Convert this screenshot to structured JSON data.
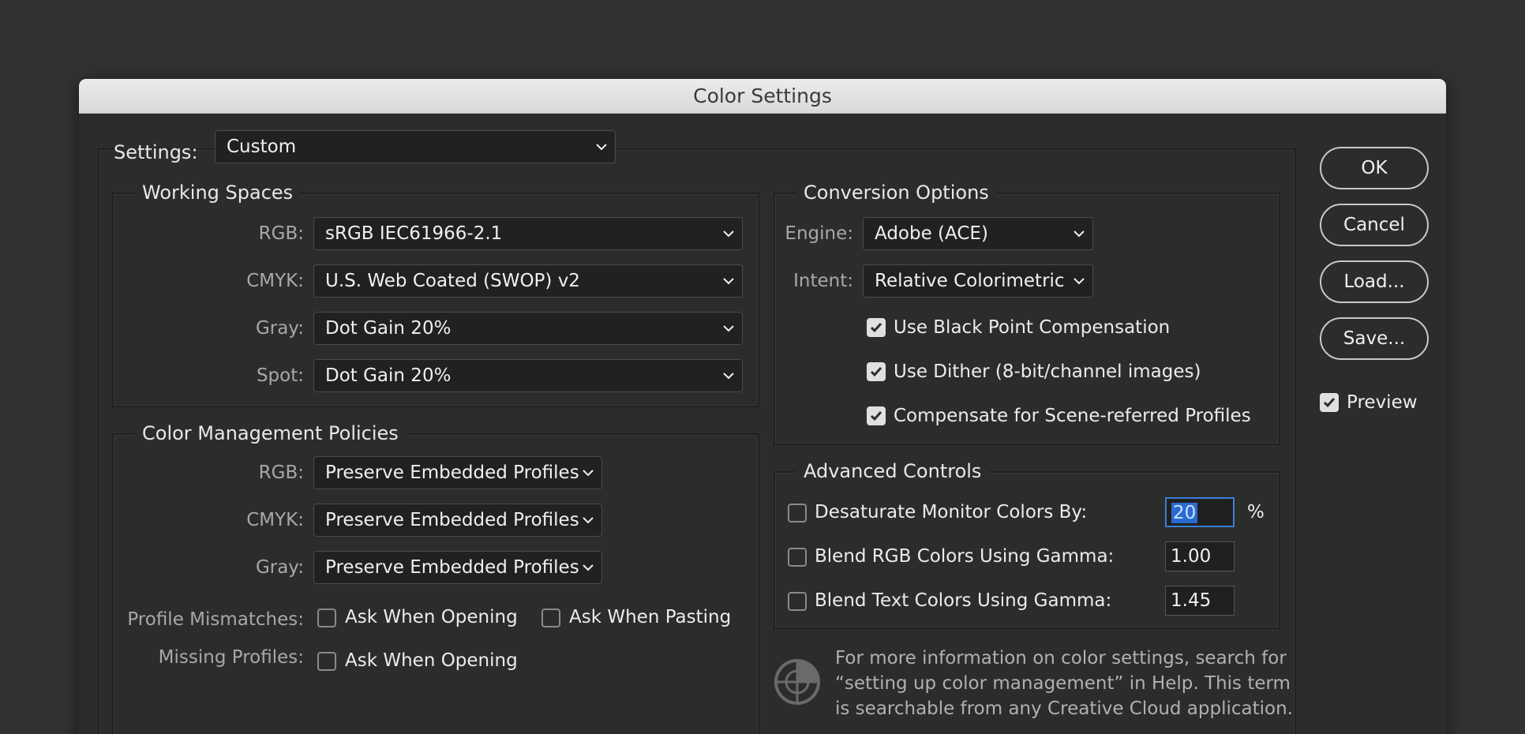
{
  "window": {
    "title": "Color Settings"
  },
  "settings": {
    "label": "Settings:",
    "value": "Custom"
  },
  "working_spaces": {
    "title": "Working Spaces",
    "rows": [
      {
        "label": "RGB:",
        "value": "sRGB IEC61966-2.1"
      },
      {
        "label": "CMYK:",
        "value": "U.S. Web Coated (SWOP) v2"
      },
      {
        "label": "Gray:",
        "value": "Dot Gain 20%"
      },
      {
        "label": "Spot:",
        "value": "Dot Gain 20%"
      }
    ]
  },
  "policies": {
    "title": "Color Management Policies",
    "rows": [
      {
        "label": "RGB:",
        "value": "Preserve Embedded Profiles"
      },
      {
        "label": "CMYK:",
        "value": "Preserve Embedded Profiles"
      },
      {
        "label": "Gray:",
        "value": "Preserve Embedded Profiles"
      }
    ],
    "mismatches_label": "Profile Mismatches:",
    "ask_opening": {
      "label": "Ask When Opening",
      "checked": false
    },
    "ask_pasting": {
      "label": "Ask When Pasting",
      "checked": false
    },
    "missing_label": "Missing Profiles:",
    "missing_ask_opening": {
      "label": "Ask When Opening",
      "checked": false
    }
  },
  "conversion": {
    "title": "Conversion Options",
    "engine_label": "Engine:",
    "engine_value": "Adobe (ACE)",
    "intent_label": "Intent:",
    "intent_value": "Relative Colorimetric",
    "checks": [
      {
        "label": "Use Black Point Compensation",
        "checked": true
      },
      {
        "label": "Use Dither (8-bit/channel images)",
        "checked": true
      },
      {
        "label": "Compensate for Scene-referred Profiles",
        "checked": true
      }
    ]
  },
  "advanced": {
    "title": "Advanced Controls",
    "rows": [
      {
        "label": "Desaturate Monitor Colors By:",
        "value": "20",
        "unit": "%",
        "checked": false
      },
      {
        "label": "Blend RGB Colors Using Gamma:",
        "value": "1.00",
        "checked": false
      },
      {
        "label": "Blend Text Colors Using Gamma:",
        "value": "1.45",
        "checked": false
      }
    ]
  },
  "info": {
    "line1": "For more information on color settings, search for",
    "line2": "“setting up color management” in Help. This term",
    "line3": "is searchable from any Creative Cloud application."
  },
  "buttons": {
    "ok": "OK",
    "cancel": "Cancel",
    "load": "Load...",
    "save": "Save..."
  },
  "preview": {
    "label": "Preview",
    "checked": true
  },
  "icons": {
    "chevron": "chevron-down-icon",
    "check": "checkmark-icon",
    "info": "color-settings-info-icon"
  }
}
